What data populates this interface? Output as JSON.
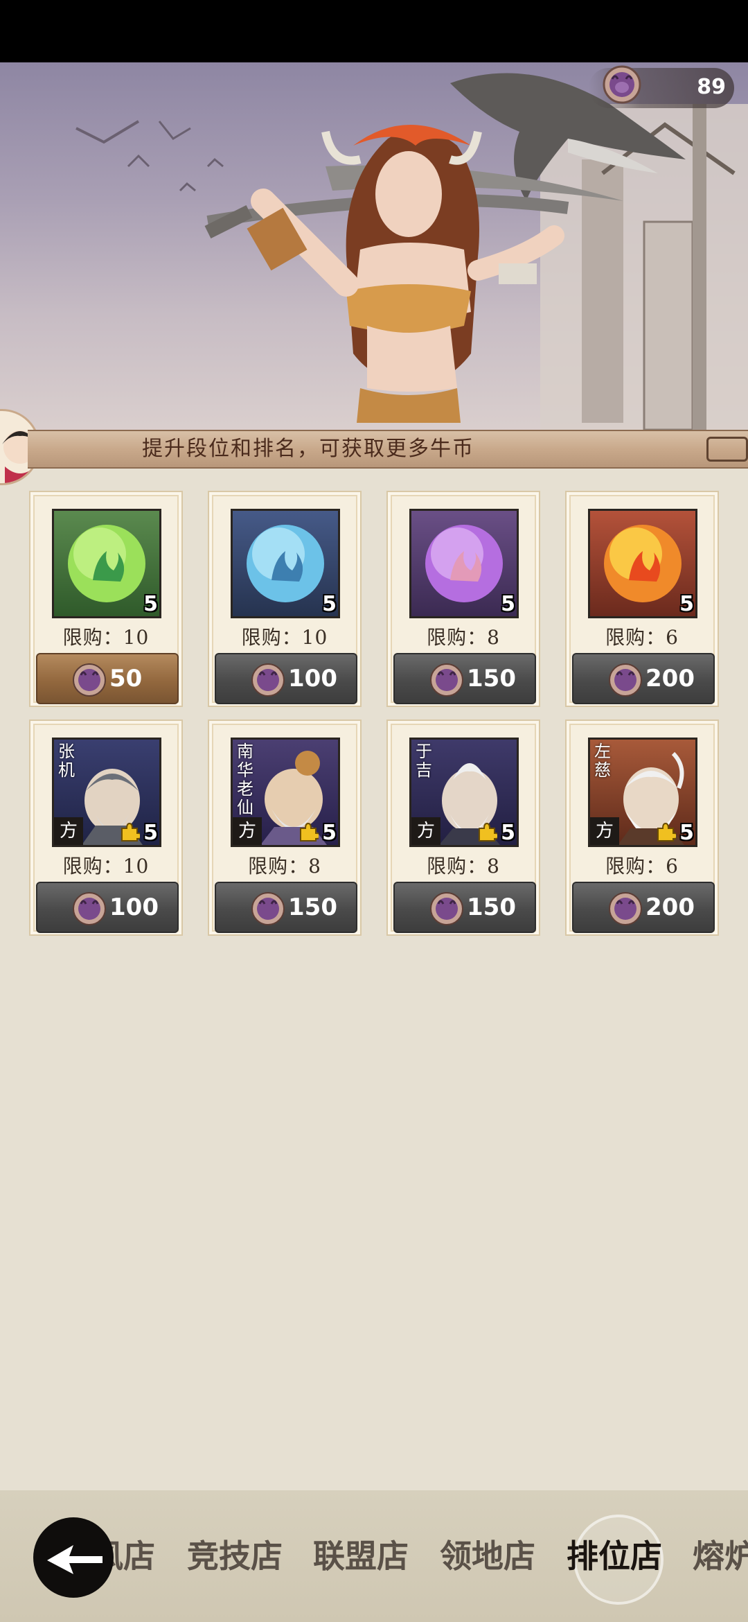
{
  "header": {
    "currency_value": "89",
    "banner_text": "提升段位和排名，可获取更多牛币"
  },
  "colors": {
    "coin": "#7a4a8c",
    "gold_button": "#93683e",
    "gray_button": "#4a4a4a"
  },
  "items": [
    {
      "type": "orb",
      "color": "green",
      "qty": "5",
      "limit": "限购：10",
      "price": "50"
    },
    {
      "type": "orb",
      "color": "blue",
      "qty": "5",
      "limit": "限购：10",
      "price": "100"
    },
    {
      "type": "orb",
      "color": "purple",
      "qty": "5",
      "limit": "限购：8",
      "price": "150"
    },
    {
      "type": "orb",
      "color": "orange",
      "qty": "5",
      "limit": "限购：6",
      "price": "200"
    },
    {
      "type": "hero",
      "name": "张机",
      "tag": "方",
      "qty": "5",
      "limit": "限购：10",
      "price": "100"
    },
    {
      "type": "hero",
      "name": "南华老仙",
      "tag": "方",
      "qty": "5",
      "limit": "限购：8",
      "price": "150"
    },
    {
      "type": "hero",
      "name": "于吉",
      "tag": "方",
      "qty": "5",
      "limit": "限购：8",
      "price": "150"
    },
    {
      "type": "hero",
      "name": "左慈",
      "tag": "方",
      "qty": "5",
      "limit": "限购：6",
      "price": "200"
    }
  ],
  "nav": {
    "tabs": [
      {
        "label": "风店"
      },
      {
        "label": "竞技店"
      },
      {
        "label": "联盟店"
      },
      {
        "label": "领地店"
      },
      {
        "label": "排位店"
      },
      {
        "label": "熔炉"
      }
    ],
    "active": "排位店"
  }
}
